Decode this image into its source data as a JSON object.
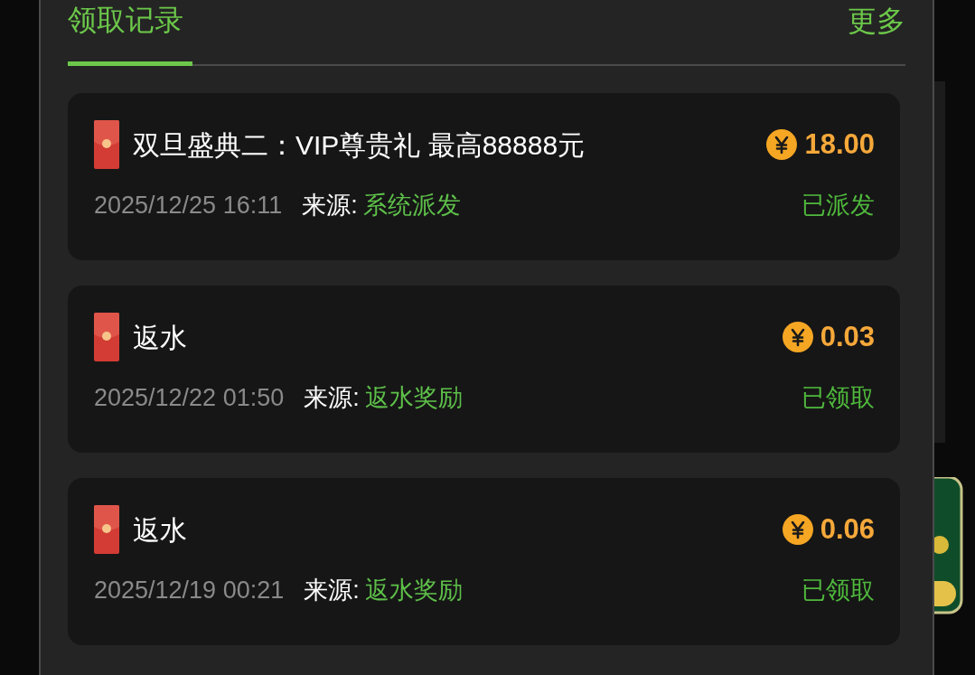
{
  "tabs": [
    {
      "label": "领取记录",
      "selected": true
    }
  ],
  "more_link": "更多",
  "records": [
    {
      "title": "双旦盛典二：VIP尊贵礼 最高88888元",
      "amount": "18.00",
      "time": "2025/12/25 16:11",
      "source_label": "来源:",
      "source": "系统派发",
      "status": "已派发"
    },
    {
      "title": "返水",
      "amount": "0.03",
      "time": "2025/12/22 01:50",
      "source_label": "来源:",
      "source": "返水奖励",
      "status": "已领取"
    },
    {
      "title": "返水",
      "amount": "0.06",
      "time": "2025/12/19 00:21",
      "source_label": "来源:",
      "source": "返水奖励",
      "status": "已领取"
    }
  ]
}
